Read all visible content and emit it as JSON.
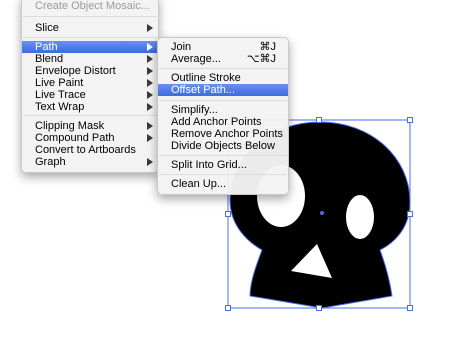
{
  "main_menu": {
    "items": [
      {
        "label": "Create Object Mosaic...",
        "disabled": true
      },
      {
        "label": "Slice",
        "submenu": true
      },
      {
        "label": "Path",
        "submenu": true,
        "highlighted": true
      },
      {
        "label": "Blend",
        "submenu": true
      },
      {
        "label": "Envelope Distort",
        "submenu": true
      },
      {
        "label": "Live Paint",
        "submenu": true
      },
      {
        "label": "Live Trace",
        "submenu": true
      },
      {
        "label": "Text Wrap",
        "submenu": true
      },
      {
        "label": "Clipping Mask",
        "submenu": true
      },
      {
        "label": "Compound Path",
        "submenu": true
      },
      {
        "label": "Convert to Artboards"
      },
      {
        "label": "Graph",
        "submenu": true
      }
    ]
  },
  "path_submenu": {
    "items": [
      {
        "label": "Join",
        "shortcut": "⌘J"
      },
      {
        "label": "Average...",
        "shortcut": "⌥⌘J"
      },
      {
        "label": "Outline Stroke"
      },
      {
        "label": "Offset Path...",
        "highlighted": true
      },
      {
        "label": "Simplify..."
      },
      {
        "label": "Add Anchor Points"
      },
      {
        "label": "Remove Anchor Points"
      },
      {
        "label": "Divide Objects Below"
      },
      {
        "label": "Split Into Grid..."
      },
      {
        "label": "Clean Up..."
      }
    ]
  },
  "colors": {
    "selection": "#4a6cf0",
    "highlight": "#3c6be0",
    "artwork_fill": "#000000"
  },
  "artwork": {
    "name": "skull-artwork",
    "selected": true
  }
}
